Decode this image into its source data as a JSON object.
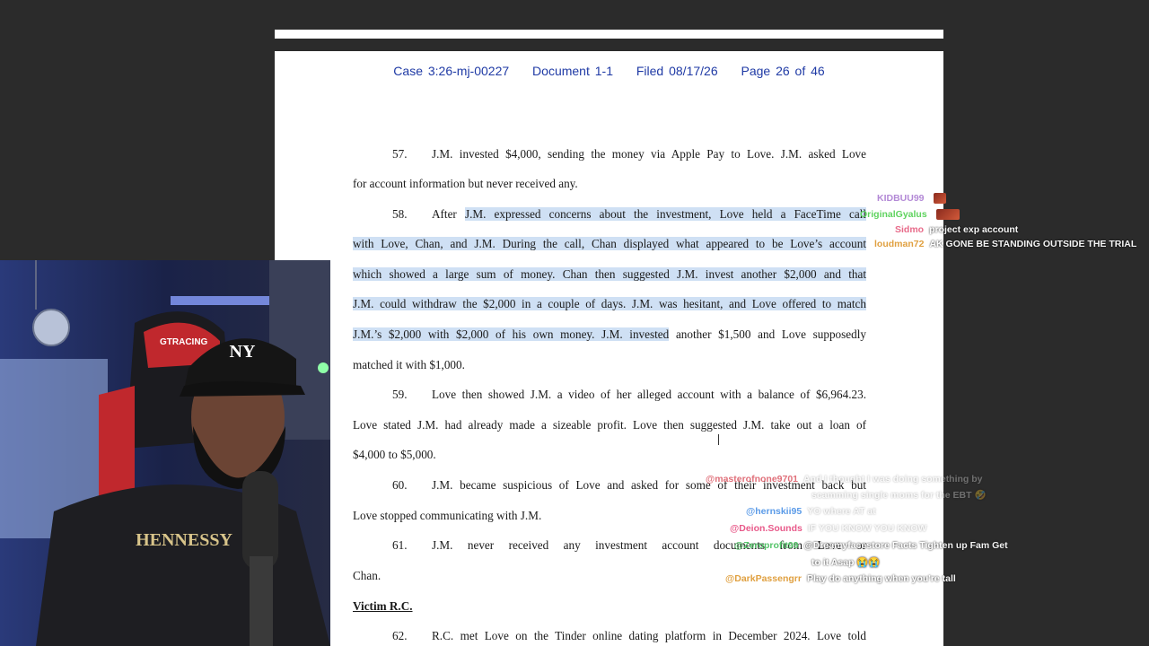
{
  "header": {
    "case": "Case 3:26-mj-00227",
    "document": "Document 1-1",
    "filed": "Filed 08/17/26",
    "page": "Page 26 of 46"
  },
  "document": {
    "lines": [
      {
        "num": "57.",
        "text": "J.M. invested $4,000, sending the money via Apple Pay to Love. J.M. asked Love"
      },
      {
        "text": "for account information but never received any."
      },
      {
        "num": "58.",
        "pre": "After ",
        "hl": "J.M. expressed concerns about the investment, Love held a FaceTime call"
      },
      {
        "hl": "with Love, Chan, and J.M. During the call, Chan displayed what appeared to be Love’s account"
      },
      {
        "hl": "which showed a large sum of money. Chan then suggested J.M. invest another $2,000 and that"
      },
      {
        "hl": "J.M. could withdraw the $2,000 in a couple of days. J.M. was hesitant, and Love offered to match"
      },
      {
        "hl": "J.M.’s $2,000 with $2,000 of his own money. J.M. invested",
        "post": " another $1,500 and Love supposedly"
      },
      {
        "text": "matched it with $1,000."
      },
      {
        "num": "59.",
        "text": "Love then showed J.M. a video of her alleged account with a balance of $6,964.23."
      },
      {
        "text": "Love stated J.M. had already made a sizeable profit. Love then suggested J.M. take out a loan of"
      },
      {
        "text": "$4,000 to $5,000."
      },
      {
        "num": "60.",
        "text": "J.M. became suspicious of Love and asked for some of their investment back but"
      },
      {
        "text": "Love stopped communicating with J.M."
      },
      {
        "num": "61.",
        "text": "J.M. never received any investment account documents from Love or"
      },
      {
        "text": "Chan."
      },
      {
        "heading": "Victim R.C."
      },
      {
        "num": "62.",
        "text": "R.C. met Love on the Tinder online dating platform in December 2024. Love told"
      }
    ]
  },
  "chat_top": [
    {
      "user": "KIDBUU99",
      "msg": "",
      "color": "#b389d6"
    },
    {
      "user": "OriginalGyalus",
      "msg": "",
      "color": "#5fd35f"
    },
    {
      "user": "Sidmo",
      "msg": "project exp account",
      "color": "#e86b8a"
    },
    {
      "user": "loudman72",
      "msg": "AK GONE BE STANDING OUTSIDE THE TRIAL",
      "color": "#e0a040"
    }
  ],
  "chat_bottom": [
    {
      "user": "@masterofnone9701",
      "msg": "And I thought I was doing something by",
      "color": "#e0707a"
    },
    {
      "user": "",
      "msg": "scamming single moms for the EBT 🤣",
      "color": "#ffffff"
    },
    {
      "user": "@hernskii95",
      "msg": "YO where AT at",
      "color": "#5b9be8"
    },
    {
      "user": "@Deion.Sounds",
      "msg": "IF YOU KNOW YOU KNOW",
      "color": "#e85a8a"
    },
    {
      "user": "@Zeroprofit99",
      "msg": "@Dreamyfacestore Facts Tighten up Fam Get",
      "color": "#55c46a"
    },
    {
      "user": "",
      "msg": "to it Asap 😭😭",
      "color": "#ffffff"
    },
    {
      "user": "@DarkPassengrr",
      "msg": "Play do anything when you're tall",
      "color": "#e0a040"
    }
  ],
  "webcam": {
    "shirt_text": "HENNESSY",
    "cap_logo": "NY",
    "chair_brand": "GTRACING"
  }
}
